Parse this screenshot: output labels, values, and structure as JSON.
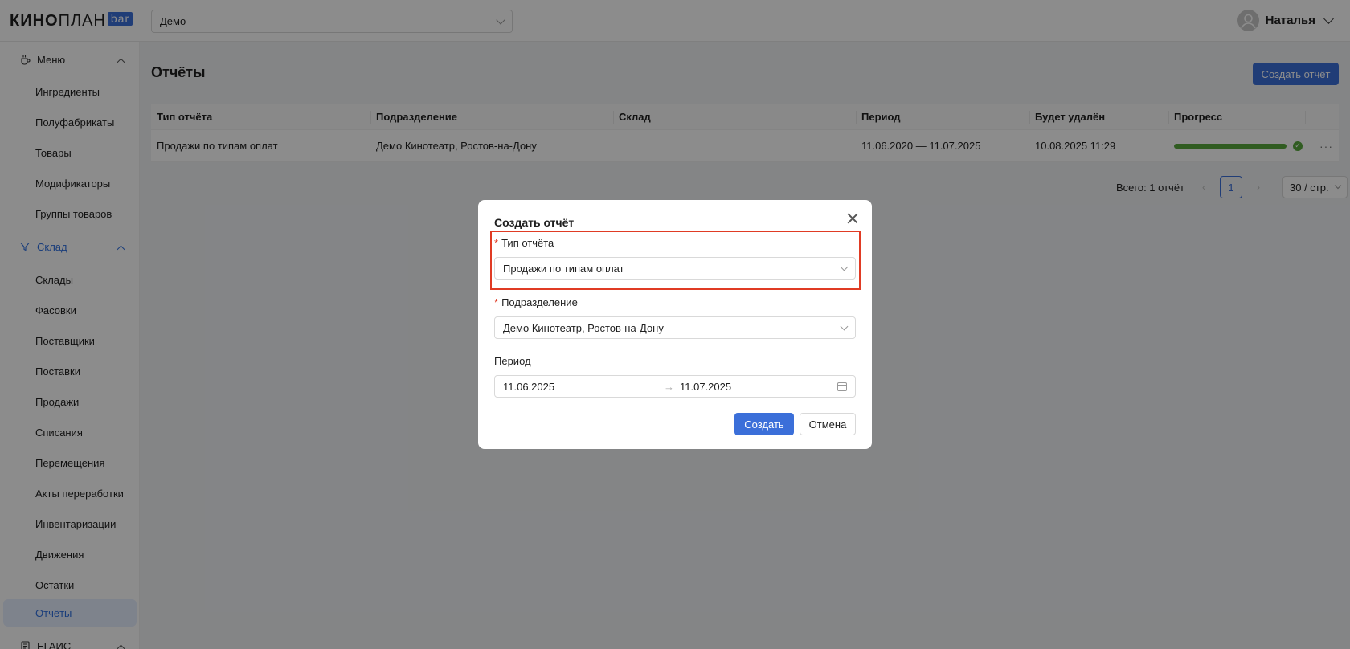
{
  "app": {
    "logo_bold": "КИНО",
    "logo_light": "ПЛАН",
    "logo_badge": "bar"
  },
  "header": {
    "org": "Демо",
    "user": "Наталья"
  },
  "sidebar": {
    "menu_group": "Меню",
    "menu_items": [
      "Ингредиенты",
      "Полуфабрикаты",
      "Товары",
      "Модификаторы",
      "Группы товаров"
    ],
    "warehouse_group": "Склад",
    "warehouse_items": [
      "Склады",
      "Фасовки",
      "Поставщики",
      "Поставки",
      "Продажи",
      "Списания",
      "Перемещения",
      "Акты переработки",
      "Инвентаризации",
      "Движения",
      "Остатки",
      "Отчёты"
    ],
    "egais_group": "ЕГАИС"
  },
  "main": {
    "title": "Отчёты",
    "create_button": "Создать отчёт",
    "columns": [
      "Тип отчёта",
      "Подразделение",
      "Склад",
      "Период",
      "Будет удалён",
      "Прогресс"
    ],
    "rows": [
      {
        "type": "Продажи по типам оплат",
        "division": "Демо Кинотеатр, Ростов-на-Дону",
        "warehouse": "",
        "period": "11.06.2020 — 11.07.2025",
        "delete_at": "10.08.2025 11:29",
        "progress": 1.0,
        "more": "···"
      }
    ],
    "pagination": {
      "total": "Всего: 1 отчёт",
      "page": "1",
      "page_size": "30 / стр.",
      "prev": "‹",
      "next": "›"
    }
  },
  "modal": {
    "title": "Создать отчёт",
    "report_type_label": "Тип отчёта",
    "report_type_value": "Продажи по типам оплат",
    "division_label": "Подразделение",
    "division_value": "Демо Кинотеатр, Ростов-на-Дону",
    "period_label": "Период",
    "period_from": "11.06.2025",
    "period_to": "11.07.2025",
    "period_arrow": "→",
    "required_mark": "*",
    "submit": "Создать",
    "cancel": "Отмена"
  },
  "colors": {
    "accent": "#3b6fd9",
    "success": "#58a83d",
    "highlight": "#e03b24"
  }
}
